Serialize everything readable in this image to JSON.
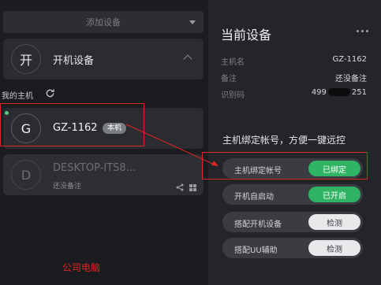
{
  "add_device": {
    "label": "添加设备"
  },
  "power_card": {
    "avatar_char": "开",
    "title": "开机设备"
  },
  "my_host": {
    "label": "我的主机"
  },
  "devices": [
    {
      "avatar_char": "G",
      "name": "GZ-1162",
      "badge": "本机",
      "online": true
    },
    {
      "avatar_char": "D",
      "name": "DESKTOP-ITS8...",
      "note": "还没备注",
      "online": false
    }
  ],
  "annotation": {
    "text": "公司电脑"
  },
  "panel": {
    "title": "当前设备",
    "info": [
      {
        "key": "主机名",
        "value": "GZ-1162"
      },
      {
        "key": "备注",
        "value": "还没备注"
      },
      {
        "key": "识别码",
        "value_prefix": "499",
        "value_suffix": "251"
      }
    ],
    "bind_title": "主机绑定帐号，方便一键远控",
    "toggles": [
      {
        "label": "主机绑定帐号",
        "button": "已绑定",
        "style": "green"
      },
      {
        "label": "开机自启动",
        "button": "已开启",
        "style": "green"
      },
      {
        "label": "搭配开机设备",
        "button": "检测",
        "style": "white"
      },
      {
        "label": "搭配UU辅助",
        "button": "检测",
        "style": "white"
      }
    ]
  },
  "colors": {
    "accent_green": "#2fb463",
    "online": "#5ec77a",
    "annotation_red": "#e02424"
  }
}
